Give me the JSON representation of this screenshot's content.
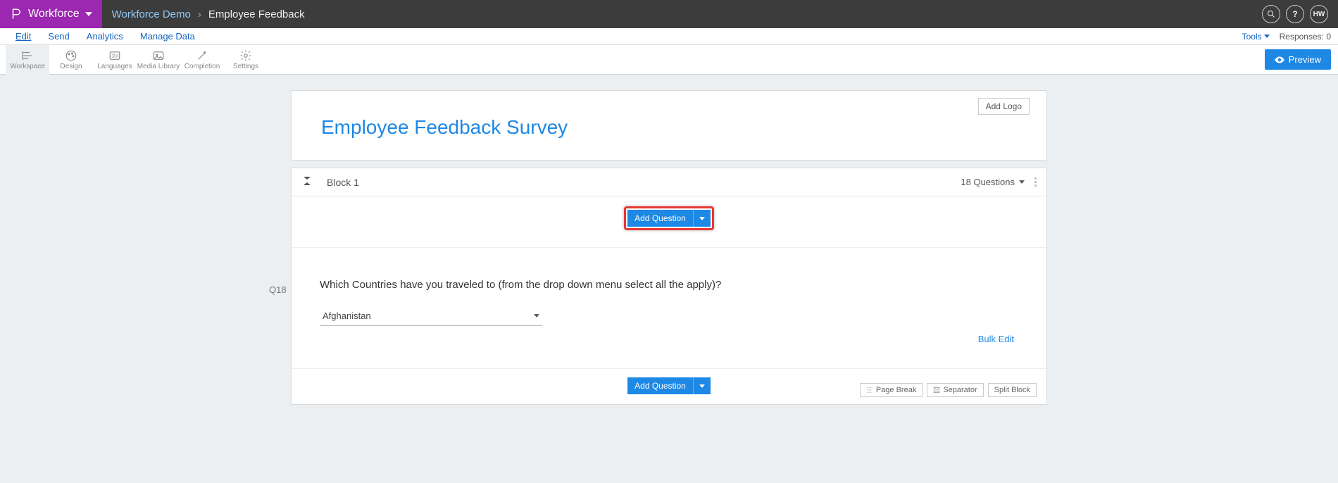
{
  "topbar": {
    "brand": "Workforce",
    "breadcrumb_link": "Workforce Demo",
    "breadcrumb_current": "Employee Feedback",
    "avatar_initials": "HW"
  },
  "menubar": {
    "items": [
      "Edit",
      "Send",
      "Analytics",
      "Manage Data"
    ],
    "tools_label": "Tools",
    "responses_label": "Responses: 0"
  },
  "toolbar": {
    "items": [
      "Workspace",
      "Design",
      "Languages",
      "Media Library",
      "Completion",
      "Settings"
    ],
    "preview_label": "Preview"
  },
  "survey": {
    "add_logo_label": "Add Logo",
    "title": "Employee Feedback Survey"
  },
  "block": {
    "name": "Block 1",
    "question_count_label": "18 Questions",
    "add_question_label": "Add Question",
    "bulk_edit_label": "Bulk Edit",
    "page_break_label": "Page Break",
    "separator_label": "Separator",
    "split_block_label": "Split Block"
  },
  "question": {
    "id": "Q18",
    "text": "Which Countries have you traveled to (from the drop down menu select all the apply)?",
    "selected_option": "Afghanistan"
  }
}
